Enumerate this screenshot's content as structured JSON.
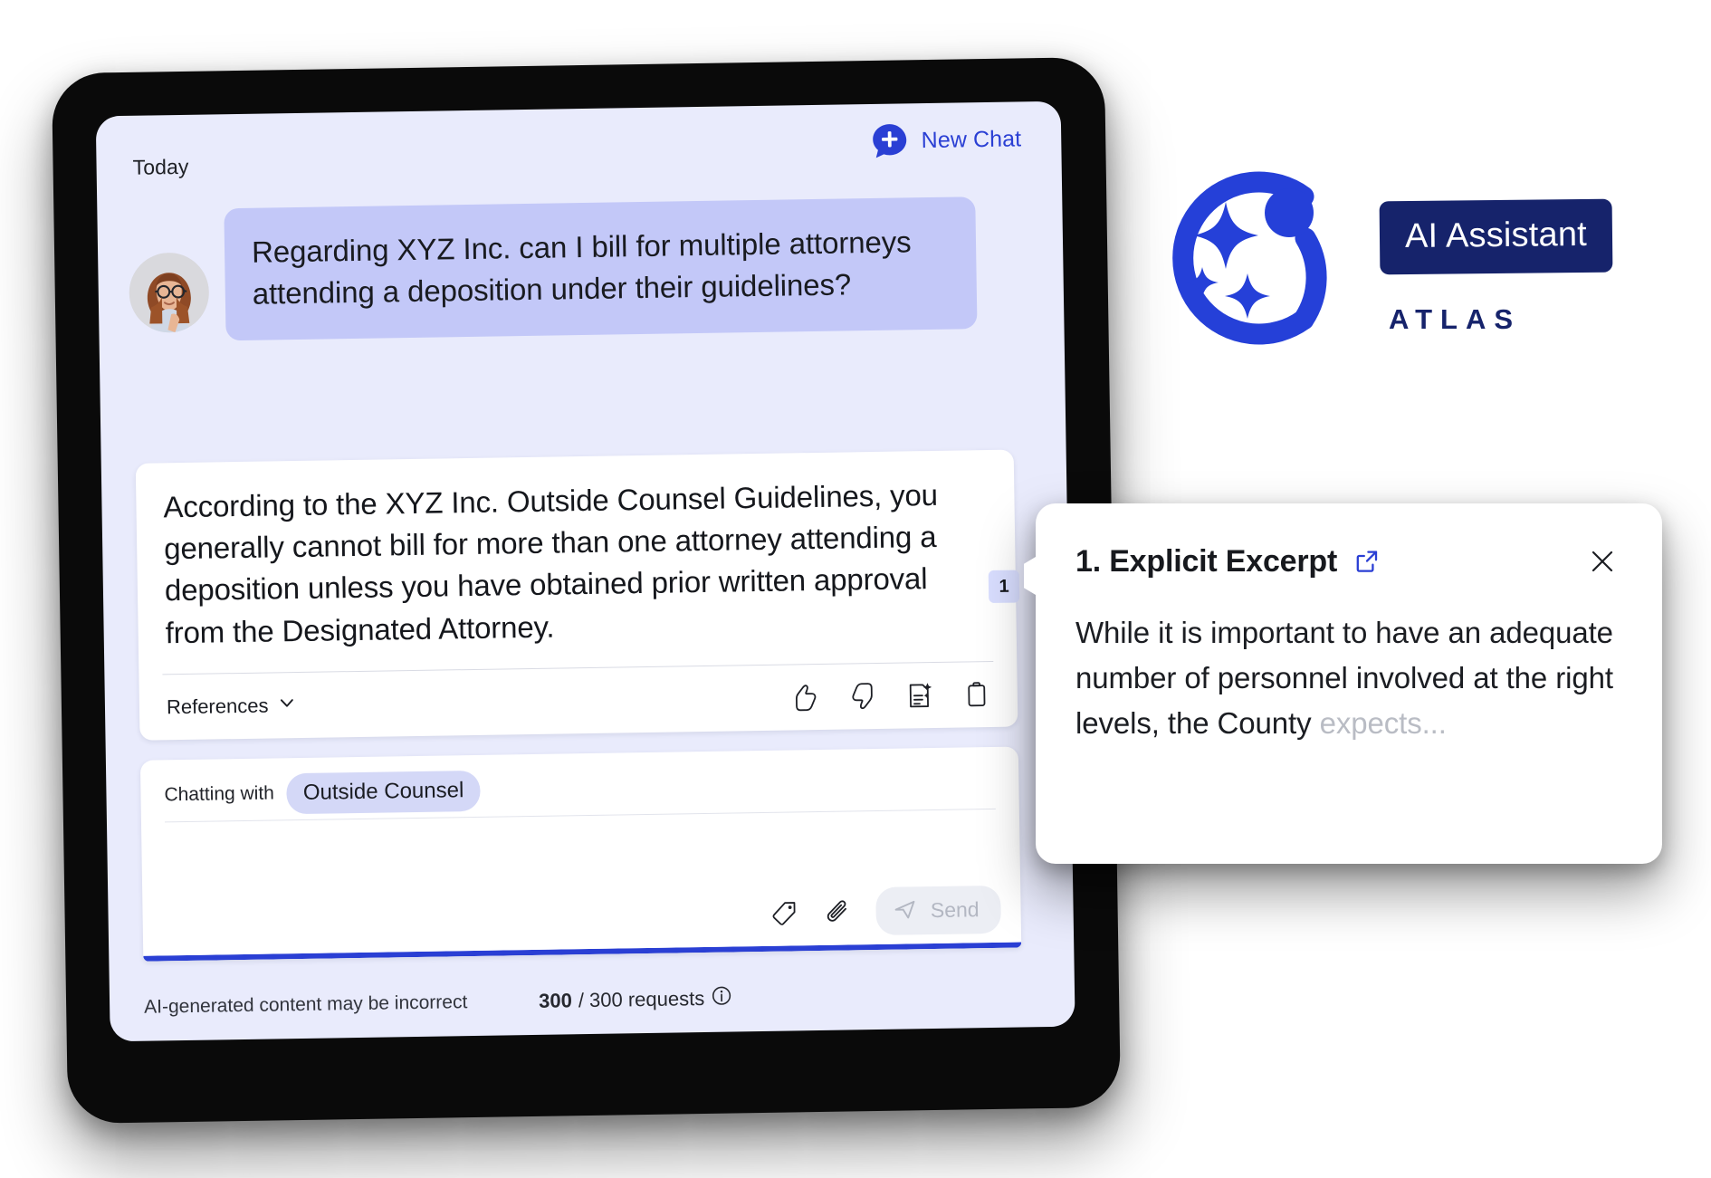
{
  "chat": {
    "day_label": "Today",
    "new_chat_label": "New Chat",
    "user_message": "Regarding XYZ Inc. can I bill for multiple attorneys attending a deposition under their guidelines?",
    "assistant_message": "According to the XYZ Inc. Outside Counsel Guidelines, you generally cannot bill for more than one attorney attending a deposition unless you have obtained prior written approval from the Designated Attorney.",
    "citation_number": "1",
    "references_label": "References",
    "actions": [
      {
        "name": "thumbs-up-icon",
        "label": "Thumbs up"
      },
      {
        "name": "thumbs-down-icon",
        "label": "Thumbs down"
      },
      {
        "name": "summarize-icon",
        "label": "Summarize"
      },
      {
        "name": "copy-icon",
        "label": "Copy"
      }
    ]
  },
  "composer": {
    "chatting_with_label": "Chatting with",
    "scope_pill": "Outside Counsel",
    "input_value": "",
    "input_placeholder": "",
    "tag_icon": "tag-icon",
    "attach_icon": "paperclip-icon",
    "send_label": "Send"
  },
  "footer": {
    "disclaimer": "AI-generated content may be incorrect",
    "requests_used": "300",
    "requests_rest": "/ 300 requests",
    "info_icon": "info-icon"
  },
  "excerpt": {
    "title": "1. Explicit Excerpt",
    "open_icon": "external-link-icon",
    "close_icon": "close-icon",
    "body_main": "While it is important to have an adequate number of personnel involved at the right levels, the County ",
    "body_fade": "expects..."
  },
  "brand": {
    "logo_icon": "atlas-sparkle-logo-icon",
    "badge_label": "AI Assistant",
    "wordmark": "ATLAS"
  },
  "colors": {
    "accent_blue": "#2a3fd4",
    "brand_navy": "#16236b",
    "screen_bg": "#e9ebfc",
    "user_bubble": "#c3c8f8",
    "pill_bg": "#d4d8f7",
    "citation_bg": "#d9deff"
  }
}
